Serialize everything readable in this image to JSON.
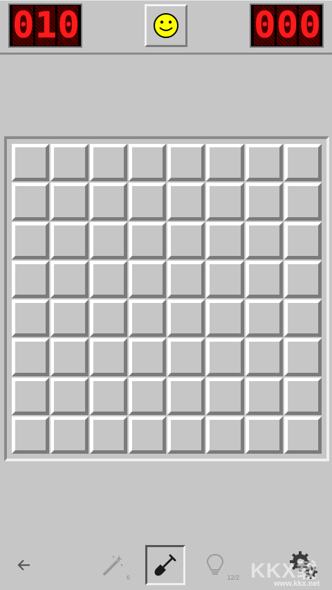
{
  "header": {
    "mine_counter": [
      "0",
      "1",
      "0"
    ],
    "timer": [
      "0",
      "0",
      "0"
    ],
    "face": "smiley"
  },
  "board": {
    "rows": 8,
    "cols": 8,
    "state": "all-unrevealed"
  },
  "toolbar": {
    "back_icon": "arrow-left-icon",
    "magic_wand_count": "6",
    "hint_count": "12/2",
    "active_tool": "shovel"
  },
  "watermark": {
    "text": "KKX载",
    "url": "www.kkx.net"
  },
  "colors": {
    "background": "#c6c6c6",
    "led_red": "#ff1a1a",
    "smiley_yellow": "#ffff00"
  }
}
